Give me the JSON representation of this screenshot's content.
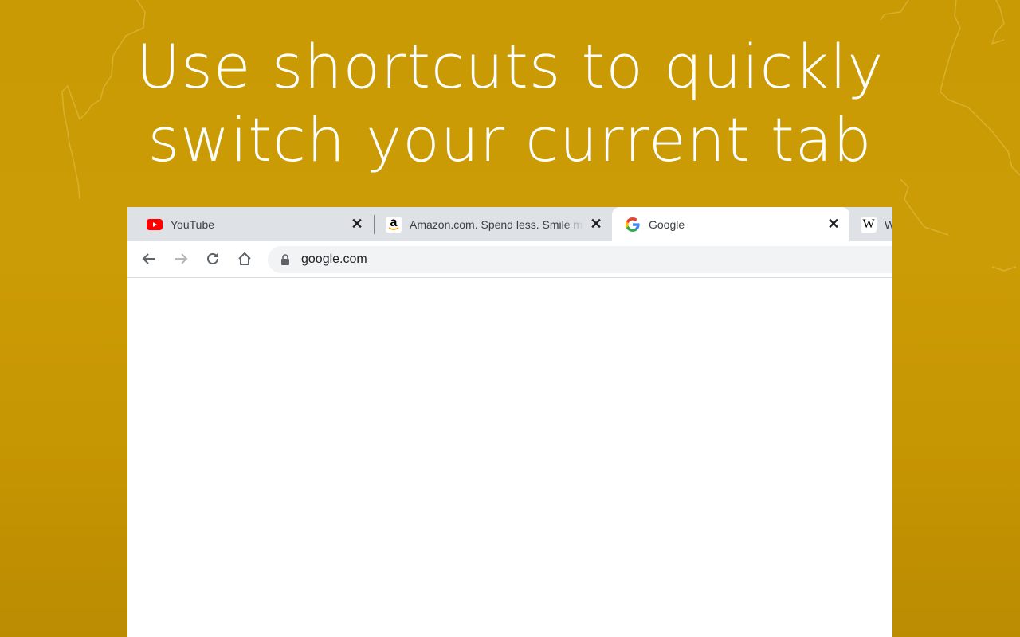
{
  "headline": {
    "line1": "Use shortcuts to quickly",
    "line2": "switch your current tab"
  },
  "colors": {
    "background": "#c99a04",
    "tabstrip": "#dee1e6",
    "omnibox": "#f1f3f4",
    "youtube_red": "#ff0000"
  },
  "browser": {
    "tabs": [
      {
        "title": "YouTube",
        "icon": "youtube-icon",
        "active": false,
        "close": "✕"
      },
      {
        "title": "Amazon.com. Spend less. Smile more.",
        "icon": "amazon-icon",
        "active": false,
        "close": "✕"
      },
      {
        "title": "Google",
        "icon": "google-icon",
        "active": true,
        "close": "✕"
      },
      {
        "title": "Wikipedia",
        "icon": "wikipedia-icon",
        "active": false,
        "close": "✕"
      }
    ],
    "toolbar": {
      "back": "back-icon",
      "forward": "forward-icon",
      "reload": "reload-icon",
      "home": "home-icon",
      "url": "google.com"
    },
    "favicon_glyphs": {
      "amazon": "a",
      "google": "G",
      "wikipedia": "W"
    }
  }
}
